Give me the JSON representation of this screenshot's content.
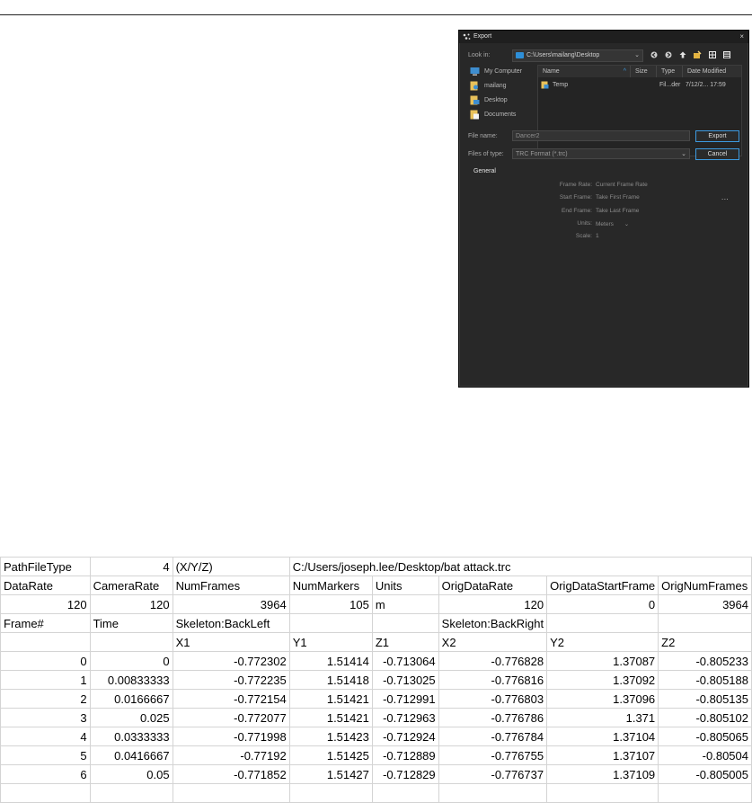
{
  "dialog": {
    "title": "Export",
    "close_glyph": "×",
    "look_in_label": "Look in:",
    "look_in_value": "C:\\Users\\mailang\\Desktop",
    "places": [
      "My Computer",
      "mailang",
      "Desktop",
      "Documents"
    ],
    "columns": [
      "Name",
      "Size",
      "Type",
      "Date Modified"
    ],
    "files": [
      {
        "name": "Temp",
        "size": "",
        "type": "Fil...der",
        "modified": "7/12/2... 17:59"
      }
    ],
    "file_name_label": "File name:",
    "file_name_value": "Dancer2",
    "files_of_type_label": "Files of type:",
    "files_of_type_value": "TRC Format (*.trc)",
    "export_button": "Export",
    "cancel_button": "Cancel",
    "section_title": "General",
    "options": [
      {
        "label": "Frame Rate:",
        "value": "Current Frame Rate"
      },
      {
        "label": "Start Frame:",
        "value": "Take First Frame"
      },
      {
        "label": "End Frame:",
        "value": "Take Last Frame"
      },
      {
        "label": "Units:",
        "value": "Meters"
      },
      {
        "label": "Scale:",
        "value": "1"
      }
    ],
    "more_glyph": "...",
    "accent_color": "#3d9ae0"
  },
  "sheet": {
    "rows": [
      [
        "PathFileType",
        "4",
        "(X/Y/Z)",
        "C:/Users/joseph.lee/Desktop/bat attack.trc",
        "",
        "",
        "",
        ""
      ],
      [
        "DataRate",
        "CameraRate",
        "NumFrames",
        "NumMarkers",
        "Units",
        "OrigDataRate",
        "OrigDataStartFrame",
        "OrigNumFrames"
      ],
      [
        "120",
        "120",
        "3964",
        "105",
        "m",
        "120",
        "0",
        "3964"
      ],
      [
        "Frame#",
        "Time",
        "Skeleton:BackLeft",
        "",
        "",
        "Skeleton:BackRight",
        "",
        ""
      ],
      [
        "",
        "",
        "X1",
        "Y1",
        "Z1",
        "X2",
        "Y2",
        "Z2"
      ],
      [
        "0",
        "0",
        "-0.772302",
        "1.51414",
        "-0.713064",
        "-0.776828",
        "1.37087",
        "-0.805233"
      ],
      [
        "1",
        "0.00833333",
        "-0.772235",
        "1.51418",
        "-0.713025",
        "-0.776816",
        "1.37092",
        "-0.805188"
      ],
      [
        "2",
        "0.0166667",
        "-0.772154",
        "1.51421",
        "-0.712991",
        "-0.776803",
        "1.37096",
        "-0.805135"
      ],
      [
        "3",
        "0.025",
        "-0.772077",
        "1.51421",
        "-0.712963",
        "-0.776786",
        "1.371",
        "-0.805102"
      ],
      [
        "4",
        "0.0333333",
        "-0.771998",
        "1.51423",
        "-0.712924",
        "-0.776784",
        "1.37104",
        "-0.805065"
      ],
      [
        "5",
        "0.0416667",
        "-0.77192",
        "1.51425",
        "-0.712889",
        "-0.776755",
        "1.37107",
        "-0.80504"
      ],
      [
        "6",
        "0.05",
        "-0.771852",
        "1.51427",
        "-0.712829",
        "-0.776737",
        "1.37109",
        "-0.805005"
      ],
      [
        "",
        "",
        "",
        "",
        "",
        "",
        "",
        ""
      ]
    ]
  }
}
